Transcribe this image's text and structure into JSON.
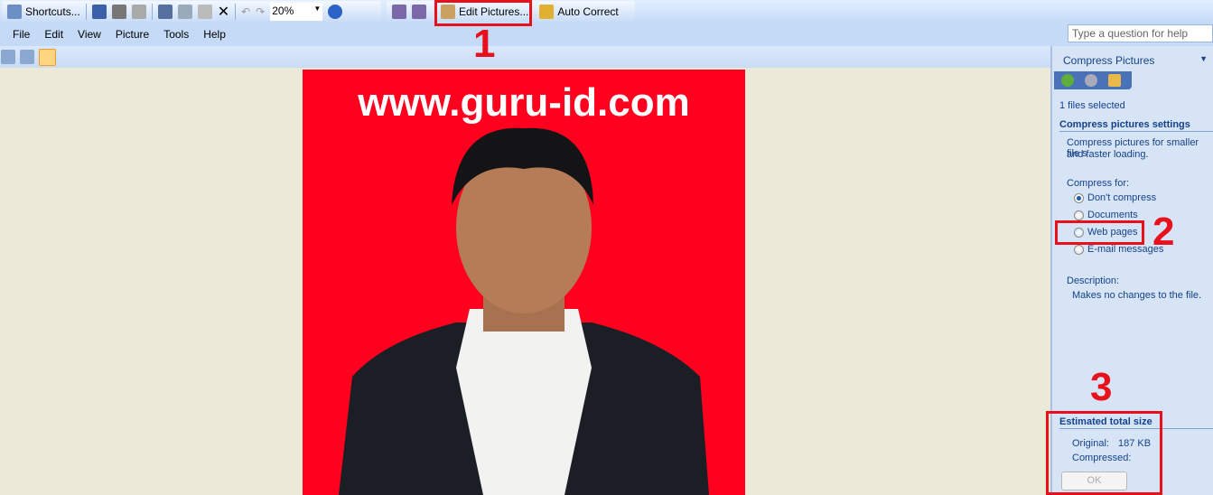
{
  "toolbar": {
    "shortcuts": "Shortcuts...",
    "zoom": "20%",
    "edit_pictures": "Edit Pictures...",
    "auto_correct": "Auto Correct"
  },
  "menu": [
    "File",
    "Edit",
    "View",
    "Picture",
    "Tools",
    "Help"
  ],
  "help_placeholder": "Type a question for help",
  "photo": {
    "watermark": "www.guru-id.com",
    "background": "#ff001e"
  },
  "pane": {
    "title": "Compress Pictures",
    "files": "1 files selected",
    "settings_header": "Compress pictures settings",
    "settings_desc1": "Compress pictures for smaller file s",
    "settings_desc2": "and faster loading.",
    "compress_for": "Compress for:",
    "options": [
      "Don't compress",
      "Documents",
      "Web pages",
      "E-mail messages"
    ],
    "selected": "Don't compress",
    "description_label": "Description:",
    "description": "Makes no changes to the file.",
    "size_header": "Estimated total size",
    "original_label": "Original:",
    "original_value": "187 KB",
    "compressed_label": "Compressed:",
    "ok": "OK"
  },
  "annotations": [
    "1",
    "2",
    "3"
  ],
  "annotation_color": "#e8101c"
}
